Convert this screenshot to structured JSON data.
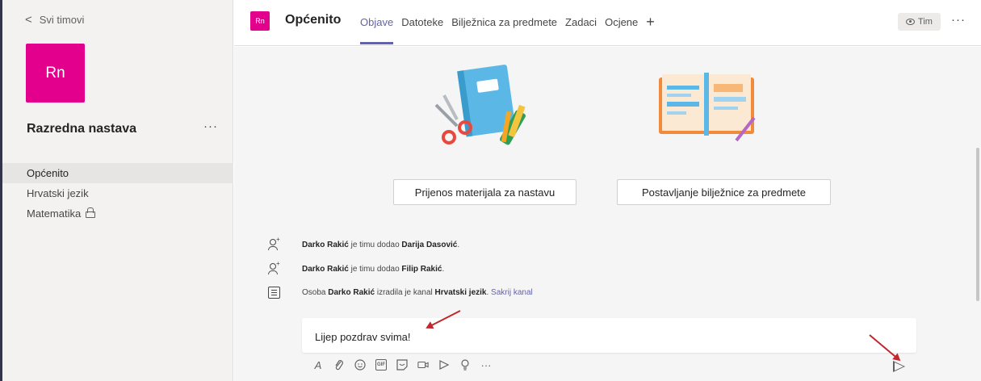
{
  "sidebar": {
    "back_label": "Svi timovi",
    "team_initials": "Rn",
    "team_name": "Razredna nastava",
    "more_label": "···",
    "channels": [
      {
        "label": "Općenito",
        "active": true
      },
      {
        "label": "Hrvatski jezik"
      },
      {
        "label": "Matematika",
        "locked": true
      }
    ]
  },
  "header": {
    "channel_initials": "Rn",
    "channel_name": "Općenito",
    "tabs": [
      {
        "label": "Objave",
        "active": true
      },
      {
        "label": "Datoteke"
      },
      {
        "label": "Bilježnica za predmete"
      },
      {
        "label": "Zadaci"
      },
      {
        "label": "Ocjene"
      }
    ],
    "add_tab": "+",
    "team_button": "Tim",
    "more_label": "···"
  },
  "main": {
    "card_buttons": [
      "Prijenos materijala za nastavu",
      "Postavljanje bilježnice za predmete"
    ],
    "activity": [
      {
        "actor": "Darko Rakić",
        "text": " je timu dodao ",
        "target": "Darija Dasović",
        "end": "."
      },
      {
        "actor": "Darko Rakić",
        "text": " je timu dodao ",
        "target": "Filip Rakić",
        "end": "."
      },
      {
        "prefix": "Osoba ",
        "actor": "Darko Rakić",
        "text": " izradila je kanal ",
        "target": "Hrvatski jezik",
        "end": ". ",
        "link": "Sakrij kanal"
      }
    ],
    "compose_text": "Lijep pozdrav svima!"
  },
  "toolbar": {
    "gif_label": "GIF",
    "more_label": "···"
  },
  "colors": {
    "team_accent": "#e3008c",
    "brand": "#6264a7",
    "annotation_arrow": "#c0282d"
  }
}
